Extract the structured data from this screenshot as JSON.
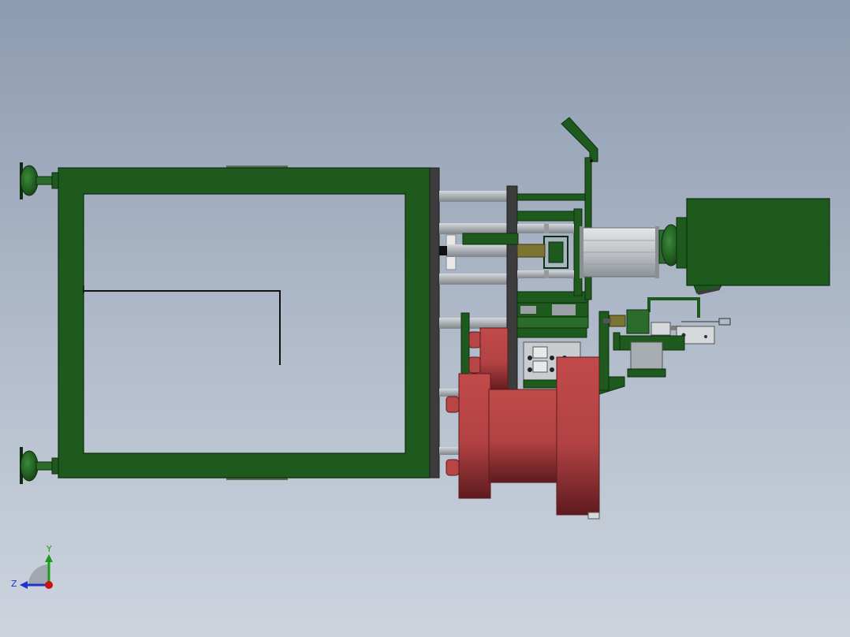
{
  "view": {
    "background_top": "#8d9bb0",
    "background_bottom": "#cdd4de"
  },
  "colors": {
    "frame_green": "#1e5a1e",
    "frame_edge": "#0f2e0f",
    "rod_gray": "#b9bec4",
    "roller_red": "#b84545",
    "roller_dark": "#6a1f22",
    "plate_dark": "#3c3c3c",
    "cylinder_silver": "#cfd3d6",
    "brass": "#7c7431"
  },
  "triad": {
    "y_label": "Y",
    "z_label": "Z",
    "y_color": "#1a9c1a",
    "z_color": "#2233cc",
    "x_color": "#cc1111"
  }
}
